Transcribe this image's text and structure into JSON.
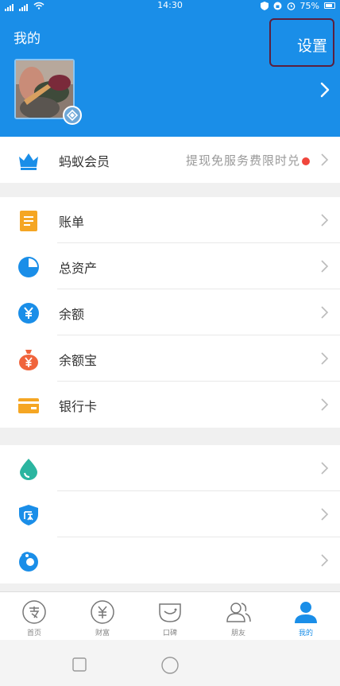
{
  "status_bar": {
    "time": "14:30",
    "battery": "75%"
  },
  "header": {
    "title": "我的",
    "settings_label": "设置"
  },
  "member_row": {
    "label": "蚂蚁会员",
    "promo": "提现免服务费限时兑",
    "icon": "crown-icon"
  },
  "menu_group_1": [
    {
      "label": "账单",
      "icon": "bill-icon",
      "color": "#f5a623"
    },
    {
      "label": "总资产",
      "icon": "pie-chart-icon",
      "color": "#1a8ee8"
    },
    {
      "label": "余额",
      "icon": "yuan-coin-icon",
      "color": "#1a8ee8"
    },
    {
      "label": "余额宝",
      "icon": "money-bag-icon",
      "color": "#f0643c"
    },
    {
      "label": "银行卡",
      "icon": "bank-card-icon",
      "color": "#f5a623"
    }
  ],
  "menu_group_2": [
    {
      "label": "",
      "icon": "drop-icon",
      "color": "#2bb5a0"
    },
    {
      "label": "",
      "icon": "insurance-shield-icon",
      "color": "#1a8ee8"
    },
    {
      "label": "",
      "icon": "ant-logo-icon",
      "color": "#1a8ee8"
    }
  ],
  "tabbar": [
    {
      "label": "首页",
      "icon": "home-icon"
    },
    {
      "label": "财富",
      "icon": "wealth-icon"
    },
    {
      "label": "口碑",
      "icon": "koubei-icon"
    },
    {
      "label": "朋友",
      "icon": "friends-icon"
    },
    {
      "label": "我的",
      "icon": "me-icon",
      "active": true
    }
  ],
  "colors": {
    "brand": "#1a8ee8",
    "accent_red": "#f0463c"
  }
}
